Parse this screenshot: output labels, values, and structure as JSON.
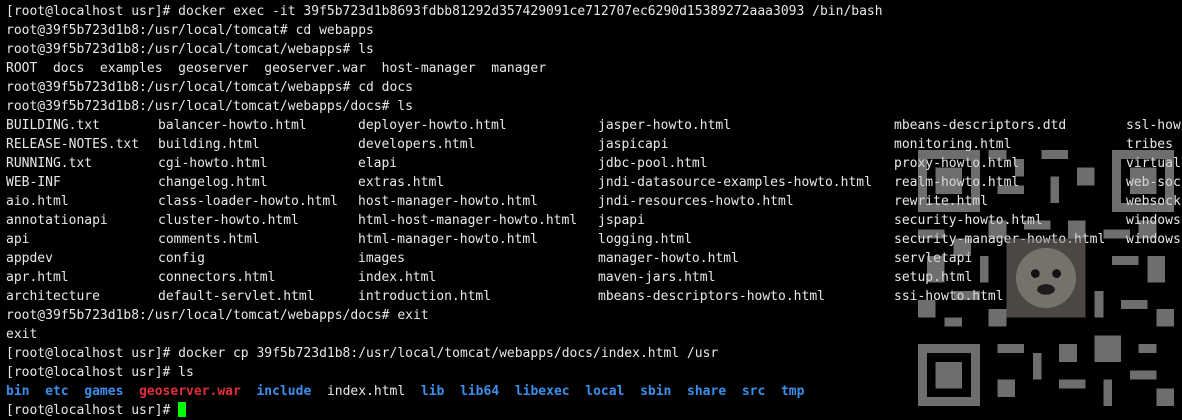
{
  "terminal": {
    "line1": "[root@localhost usr]# docker exec -it 39f5b723d1b8693fdbb81292d357429091ce712707ec6290d15389272aaa3093 /bin/bash",
    "line2": "root@39f5b723d1b8:/usr/local/tomcat# cd webapps",
    "line3": "root@39f5b723d1b8:/usr/local/tomcat/webapps# ls",
    "line4": "ROOT  docs  examples  geoserver  geoserver.war  host-manager  manager",
    "line5": "root@39f5b723d1b8:/usr/local/tomcat/webapps# cd docs",
    "line6": "root@39f5b723d1b8:/usr/local/tomcat/webapps/docs# ls",
    "ls_rows": [
      [
        "BUILDING.txt",
        "balancer-howto.html",
        "deployer-howto.html",
        "jasper-howto.html",
        "mbeans-descriptors.dtd",
        "ssl-how"
      ],
      [
        "RELEASE-NOTES.txt",
        "building.html",
        "developers.html",
        "jaspicapi",
        "monitoring.html",
        "tribes"
      ],
      [
        "RUNNING.txt",
        "cgi-howto.html",
        "elapi",
        "jdbc-pool.html",
        "proxy-howto.html",
        "virtual"
      ],
      [
        "WEB-INF",
        "changelog.html",
        "extras.html",
        "jndi-datasource-examples-howto.html",
        "realm-howto.html",
        "web-soc"
      ],
      [
        "aio.html",
        "class-loader-howto.html",
        "host-manager-howto.html",
        "jndi-resources-howto.html",
        "rewrite.html",
        "websock"
      ],
      [
        "annotationapi",
        "cluster-howto.html",
        "html-host-manager-howto.html",
        "jspapi",
        "security-howto.html",
        "windows"
      ],
      [
        "api",
        "comments.html",
        "html-manager-howto.html",
        "logging.html",
        "security-manager-howto.html",
        "windows"
      ],
      [
        "appdev",
        "config",
        "images",
        "manager-howto.html",
        "servletapi",
        ""
      ],
      [
        "apr.html",
        "connectors.html",
        "index.html",
        "maven-jars.html",
        "setup.html",
        ""
      ],
      [
        "architecture",
        "default-servlet.html",
        "introduction.html",
        "mbeans-descriptors-howto.html",
        "ssi-howto.html",
        ""
      ]
    ],
    "line17": "root@39f5b723d1b8:/usr/local/tomcat/webapps/docs# exit",
    "line18": "exit",
    "line19": "[root@localhost usr]# docker cp 39f5b723d1b8:/usr/local/tomcat/webapps/docs/index.html /usr",
    "line20": "[root@localhost usr]# ls",
    "usr_ls": [
      {
        "name": "bin",
        "kind": "dir"
      },
      {
        "name": "etc",
        "kind": "dir"
      },
      {
        "name": "games",
        "kind": "dir"
      },
      {
        "name": "geoserver.war",
        "kind": "archive"
      },
      {
        "name": "include",
        "kind": "dir"
      },
      {
        "name": "index.html",
        "kind": "file"
      },
      {
        "name": "lib",
        "kind": "dir"
      },
      {
        "name": "lib64",
        "kind": "dir"
      },
      {
        "name": "libexec",
        "kind": "dir"
      },
      {
        "name": "local",
        "kind": "dir"
      },
      {
        "name": "sbin",
        "kind": "dir"
      },
      {
        "name": "share",
        "kind": "dir"
      },
      {
        "name": "src",
        "kind": "dir"
      },
      {
        "name": "tmp",
        "kind": "dir"
      }
    ],
    "prompt_final": "[root@localhost usr]# "
  },
  "colors": {
    "background": "#000000",
    "text": "#e8e8e8",
    "directory": "#3b8eea",
    "archive": "#e0303a",
    "cursor": "#00ff00"
  },
  "icons": {
    "overlay": "qr-code-icon"
  }
}
